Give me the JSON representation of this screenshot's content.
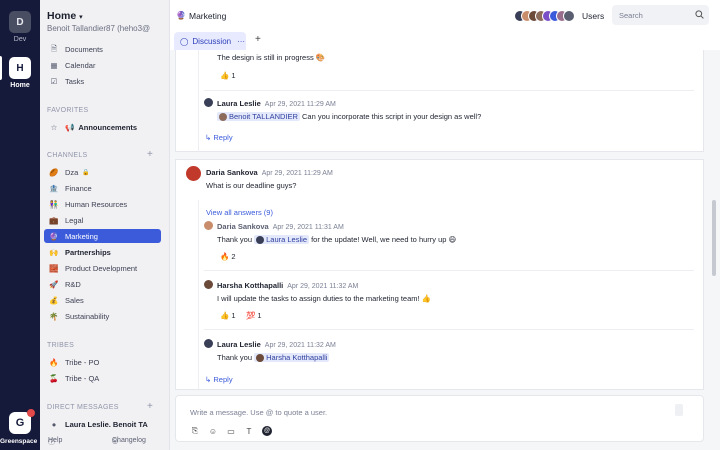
{
  "rail": {
    "workspaces": [
      {
        "letter": "D",
        "label": "Dev"
      },
      {
        "letter": "H",
        "label": "Home"
      }
    ],
    "brand_letter": "G",
    "brand_label": "Greenspace"
  },
  "sidebar": {
    "title": "Home",
    "user": "Benoit Tallandier87 (heho3@",
    "nav": [
      {
        "icon": "documents-icon",
        "glyph": "🗎",
        "label": "Documents"
      },
      {
        "icon": "calendar-icon",
        "glyph": "▦",
        "label": "Calendar"
      },
      {
        "icon": "tasks-icon",
        "glyph": "☑",
        "label": "Tasks"
      }
    ],
    "favorites_header": "FAVORITES",
    "favorites": [
      {
        "label": "Announcements",
        "glyph": "📢"
      }
    ],
    "channels_header": "CHANNELS",
    "channels": [
      {
        "label": "Dza",
        "glyph": "🏉",
        "lock": true
      },
      {
        "label": "Finance",
        "glyph": "🏦"
      },
      {
        "label": "Human Resources",
        "glyph": "👫"
      },
      {
        "label": "Legal",
        "glyph": "💼"
      },
      {
        "label": "Marketing",
        "glyph": "🔮",
        "active": true
      },
      {
        "label": "Partnerships",
        "glyph": "🙌",
        "bold": true
      },
      {
        "label": "Product Development",
        "glyph": "🧱"
      },
      {
        "label": "R&D",
        "glyph": "🚀"
      },
      {
        "label": "Sales",
        "glyph": "💰"
      },
      {
        "label": "Sustainability",
        "glyph": "🌴"
      }
    ],
    "tribes_header": "TRIBES",
    "tribes": [
      {
        "label": "Tribe - PO",
        "glyph": "🔥"
      },
      {
        "label": "Tribe - QA",
        "glyph": "🍒"
      }
    ],
    "dm_header": "DIRECT MESSAGES",
    "dm_partial": "Laura Leslie, Benoit TA",
    "help_label": "Help",
    "changelog_label": "Changelog"
  },
  "topbar": {
    "channel_glyph": "🔮",
    "channel": "Marketing",
    "users_label": "Users",
    "search_placeholder": "Search"
  },
  "tabs": {
    "discussion": "Discussion",
    "more": "···",
    "add": "+"
  },
  "thread1": {
    "partial_text": "The design is still in progress 🎨",
    "reaction1": "👍 1",
    "reply_name": "Laura Leslie",
    "reply_time": "Apr 29, 2021 11:29 AM",
    "reply_mention": "Benoit TALLANDIER",
    "reply_text": "Can you incorporate this script in your design as well?",
    "reply_link": "Reply"
  },
  "thread2": {
    "author": "Daria Sankova",
    "time": "Apr 29, 2021 11:29 AM",
    "text": "What is our deadline guys?",
    "view_all": "View all answers (9)",
    "r1_name": "Daria Sankova",
    "r1_time": "Apr 29, 2021 11:31 AM",
    "r1_pre": "Thank you",
    "r1_mention": "Laura Leslie",
    "r1_post": "for the update! Well, we need to hurry up 😄",
    "r1_reaction": "🔥 2",
    "r2_name": "Harsha Kotthapalli",
    "r2_time": "Apr 29, 2021 11:32 AM",
    "r2_text": "I will update the tasks to assign duties to the marketing team! 👍",
    "r2_reaction_a": "👍 1",
    "r2_reaction_b": "💯 1",
    "r3_name": "Laura Leslie",
    "r3_time": "Apr 29, 2021 11:32 AM",
    "r3_pre": "Thank you",
    "r3_mention": "Harsha Kotthapalli",
    "reply_link": "Reply"
  },
  "composer": {
    "placeholder": "Write a message. Use @ to quote a user."
  },
  "colors": {
    "rail": "#161a3a",
    "accent": "#3b5bdb",
    "sidebar": "#f1f1f4"
  }
}
